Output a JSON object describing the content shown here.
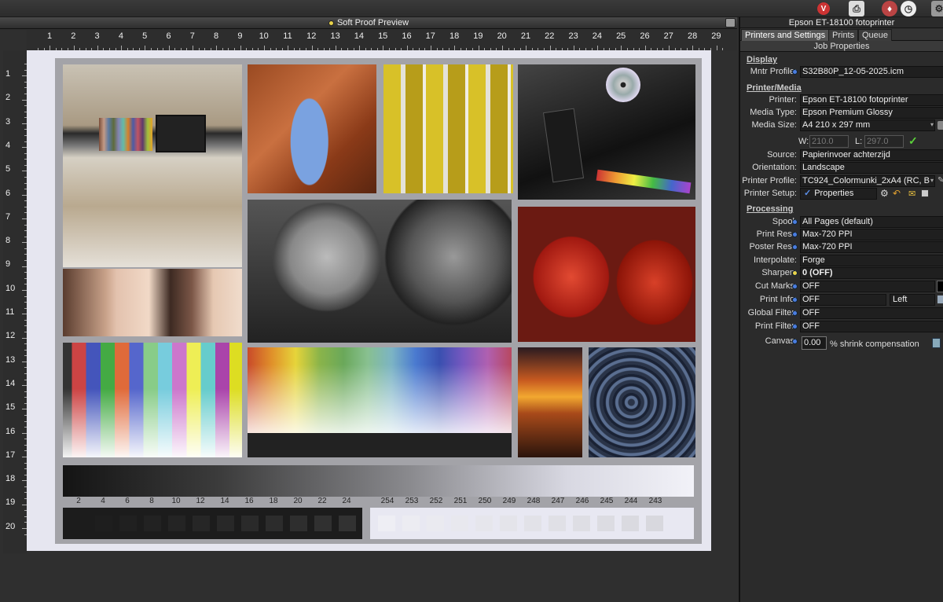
{
  "topbar": {
    "icons": [
      "v-logo-icon",
      "printer-icon",
      "flame-icon",
      "clock-icon",
      "gear-icon"
    ]
  },
  "preview": {
    "title": "Soft Proof Preview"
  },
  "ruler_h": [
    "1",
    "2",
    "3",
    "4",
    "5",
    "6",
    "7",
    "8",
    "9",
    "10",
    "11",
    "12",
    "13",
    "14",
    "15",
    "16",
    "17",
    "18",
    "19",
    "20",
    "21",
    "22",
    "23",
    "24",
    "25",
    "26",
    "27",
    "28",
    "29"
  ],
  "ruler_v": [
    "1",
    "2",
    "3",
    "4",
    "5",
    "6",
    "7",
    "8",
    "9",
    "10",
    "11",
    "12",
    "13",
    "14",
    "15",
    "16",
    "17",
    "18",
    "19",
    "20"
  ],
  "print": {
    "left_steps": [
      "2",
      "4",
      "6",
      "8",
      "10",
      "12",
      "14",
      "16",
      "18",
      "20",
      "22",
      "24"
    ],
    "right_steps": [
      "254",
      "253",
      "252",
      "251",
      "250",
      "249",
      "248",
      "247",
      "246",
      "245",
      "244",
      "243"
    ]
  },
  "panel": {
    "printer_title": "Epson ET-18100 fotoprinter",
    "tabs": [
      "Printers and Settings",
      "Prints",
      "Queue"
    ],
    "job_props": "Job Properties",
    "display_heading": "Display",
    "mntr_label": "Mntr Profile:",
    "mntr_value": "S32B80P_12-05-2025.icm",
    "printer_media_heading": "Printer/Media",
    "printer_label": "Printer:",
    "printer_value": "Epson ET-18100 fotoprinter",
    "media_type_label": "Media Type:",
    "media_type_value": "Epson Premium Glossy",
    "media_size_label": "Media Size:",
    "media_size_value": "A4 210 x 297 mm",
    "w_label": "W:",
    "w_value": "210.0",
    "l_label": "L:",
    "l_value": "297.0",
    "source_label": "Source:",
    "source_value": "Papierinvoer achterzijd",
    "orientation_label": "Orientation:",
    "orientation_value": "Landscape",
    "printer_profile_label": "Printer Profile:",
    "printer_profile_value": "TC924_Colormunki_2xA4 (RC, B",
    "printer_setup_label": "Printer Setup:",
    "properties_label": "Properties",
    "processing_heading": "Processing",
    "spool_label": "Spool:",
    "spool_value": "All Pages (default)",
    "print_res_label": "Print Res.:",
    "print_res_value": "Max-720 PPI",
    "poster_res_label": "Poster Res.:",
    "poster_res_value": "Max-720 PPI",
    "interpolate_label": "Interpolate:",
    "interpolate_value": "Forge",
    "sharpen_label": "Sharpen:",
    "sharpen_value": "0 (OFF)",
    "cut_marks_label": "Cut Marks:",
    "cut_marks_value": "OFF",
    "print_info_label": "Print Info:",
    "print_info_value": "OFF",
    "print_info_align": "Left",
    "global_filter_label": "Global Filter:",
    "global_filter_value": "OFF",
    "print_filter_label": "Print Filter:",
    "print_filter_value": "OFF",
    "canvas_label": "Canvas:",
    "canvas_value": "0.00",
    "canvas_suffix": "% shrink compensation"
  }
}
